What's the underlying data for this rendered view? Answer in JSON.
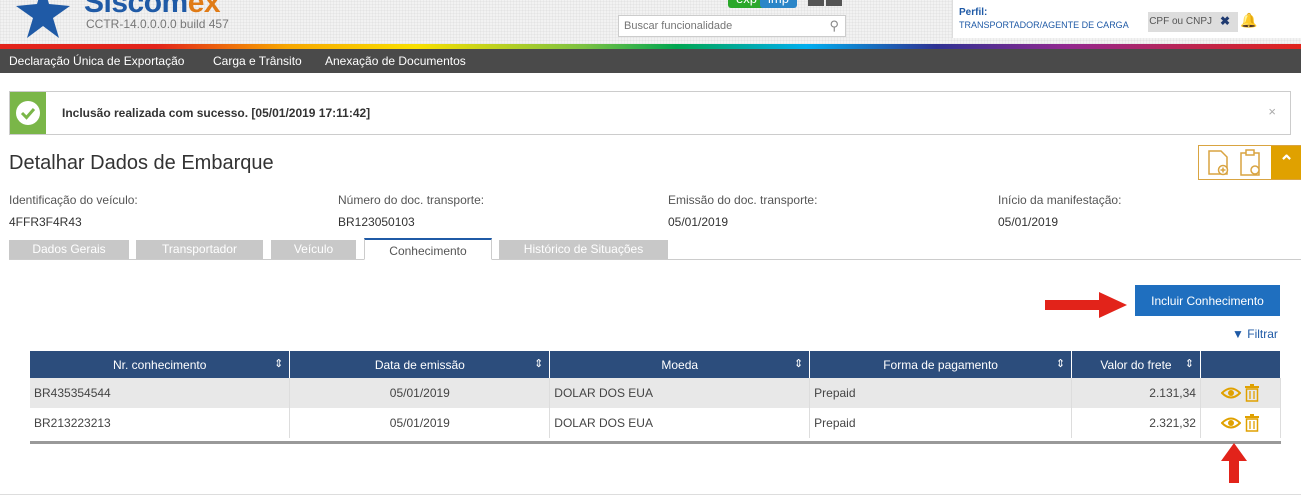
{
  "header": {
    "logo_main": "Siscom",
    "logo_accent": "ex",
    "build": "CCTR-14.0.0.0.0 build 457",
    "mode_exp": "exp",
    "mode_imp": "imp",
    "search_placeholder": "Buscar funcionalidade",
    "profile_label": "Perfil:",
    "profile_value": "TRANSPORTADOR/AGENTE DE CARGA",
    "cpf_label": "CPF ou CNPJ"
  },
  "nav": {
    "items": [
      "Declaração Única de Exportação",
      "Carga e Trânsito",
      "Anexação de Documentos"
    ]
  },
  "alert": {
    "message": "Inclusão realizada com sucesso. [05/01/2019 17:11:42]",
    "close": "×"
  },
  "page": {
    "title": "Detalhar Dados de Embarque"
  },
  "info": [
    {
      "label": "Identificação do veículo:",
      "value": "4FFR3F4R43"
    },
    {
      "label": "Número do doc. transporte:",
      "value": "BR123050103"
    },
    {
      "label": "Emissão do doc. transporte:",
      "value": "05/01/2019"
    },
    {
      "label": "Início da manifestação:",
      "value": "05/01/2019"
    }
  ],
  "tabs": [
    "Dados Gerais",
    "Transportador",
    "Veículo",
    "Conhecimento",
    "Histórico de Situações"
  ],
  "actions": {
    "incluir": "Incluir Conhecimento",
    "filtrar": "Filtrar"
  },
  "table": {
    "columns": [
      "Nr. conhecimento",
      "Data de emissão",
      "Moeda",
      "Forma de pagamento",
      "Valor do frete"
    ],
    "rows": [
      {
        "numero": "BR435354544",
        "data": "05/01/2019",
        "moeda": "DOLAR DOS EUA",
        "pagamento": "Prepaid",
        "valor": "2.131,34"
      },
      {
        "numero": "BR213223213",
        "data": "05/01/2019",
        "moeda": "DOLAR DOS EUA",
        "pagamento": "Prepaid",
        "valor": "2.321,32"
      }
    ]
  },
  "colors": {
    "brand": "#1f5aa6",
    "accent": "#e07b16",
    "success": "#7ab648",
    "table_header": "#2c4d7c",
    "arrow": "#e2231a",
    "action_icon": "#e0a100"
  }
}
